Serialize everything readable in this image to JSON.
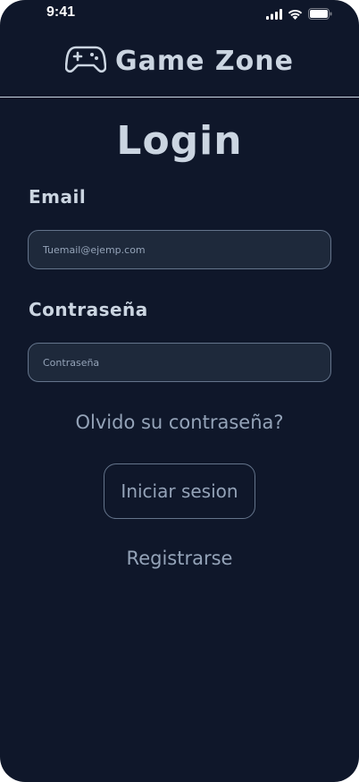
{
  "status_bar": {
    "time": "9:41",
    "icons": [
      "signal-icon",
      "wifi-icon",
      "battery-icon"
    ]
  },
  "header": {
    "logo_icon": "gamepad-icon",
    "app_name": "Game Zone"
  },
  "page_title": "Login",
  "form": {
    "email_label": "Email",
    "email_placeholder": "Tuemail@ejemp.com",
    "password_label": "Contraseña",
    "password_placeholder": "Contraseña"
  },
  "links": {
    "forgot_password": "Olvido su contraseña?",
    "login_button": "Iniciar sesion",
    "register": "Registrarse"
  },
  "colors": {
    "background": "#0f172a",
    "text_primary": "#cbd5e1",
    "text_muted": "#94a3b8",
    "input_background": "#1e293b",
    "border": "#64748b"
  }
}
